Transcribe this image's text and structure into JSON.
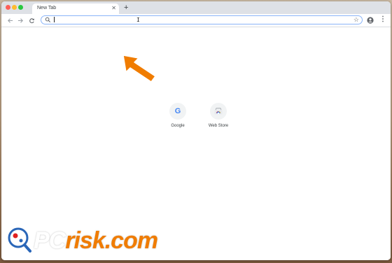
{
  "browser": {
    "tab": {
      "title": "New Tab",
      "close_icon": "close-icon"
    },
    "new_tab_icon": "plus-icon",
    "toolbar": {
      "back_icon": "arrow-left-icon",
      "forward_icon": "arrow-right-icon",
      "reload_icon": "reload-icon",
      "omnibox": {
        "value": "",
        "icon": "search-icon"
      },
      "bookmark_icon": "star-icon",
      "profile_icon": "profile-icon",
      "menu_icon": "more-vertical-icon"
    }
  },
  "shortcuts": [
    {
      "label": "Google",
      "icon": "google-icon"
    },
    {
      "label": "Web Store",
      "icon": "web-store-icon"
    }
  ],
  "watermark": {
    "text": "PCrisk.com"
  },
  "colors": {
    "accent_orange": "#f07c00",
    "tab_strip": "#dee1e6",
    "omnibox_focus": "#8ab4f8"
  }
}
